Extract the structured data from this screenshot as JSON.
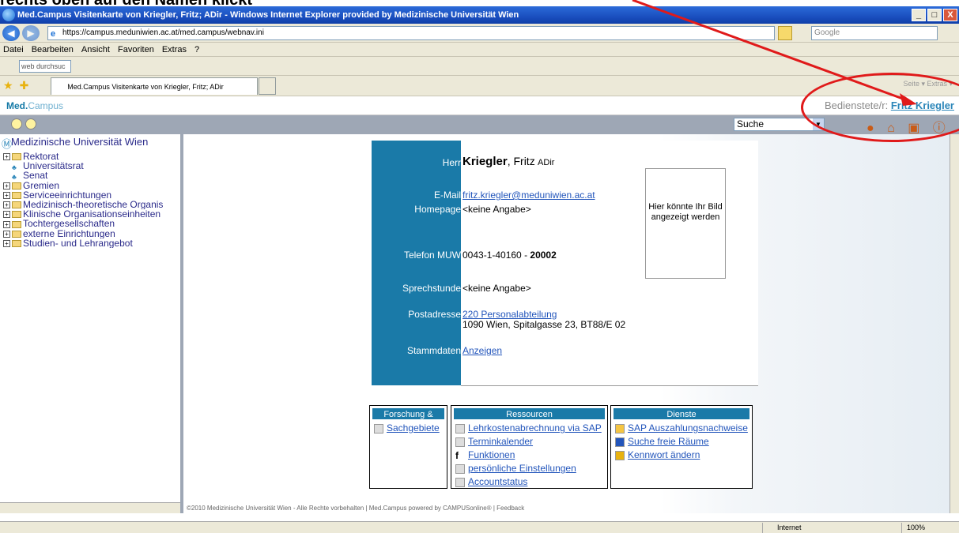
{
  "window": {
    "title": "Med.Campus Visitenkarte von Kriegler, Fritz; ADir - Windows Internet Explorer provided by Medizinische Universität Wien",
    "min": "_",
    "max": "□",
    "close": "X"
  },
  "browser": {
    "url": "https://campus.meduniwien.ac.at/med.campus/webnav.ini",
    "search_placeholder": "Google",
    "menu": [
      "Datei",
      "Bearbeiten",
      "Ansicht",
      "Favoriten",
      "Extras",
      "?"
    ],
    "web_search": "web durchsuc",
    "tab_title": "Med.Campus Visitenkarte von Kriegler, Fritz; ADir",
    "right_cmds": "Seite ▾  Extras ▾",
    "status_zone": "Internet",
    "zoom": "100%"
  },
  "app": {
    "brand_main": "Med.",
    "brand_sub": "Campus",
    "user_prefix": "Bedienstete/r: ",
    "user_name": "Fritz Kriegler",
    "search_select": "Suche"
  },
  "sidebar": {
    "title": "Medizinische Universität Wien",
    "items": [
      {
        "label": "Rektorat",
        "type": "folder"
      },
      {
        "label": "Universitätsrat",
        "type": "person"
      },
      {
        "label": "Senat",
        "type": "person"
      },
      {
        "label": "Gremien",
        "type": "folder"
      },
      {
        "label": "Serviceeinrichtungen",
        "type": "folder"
      },
      {
        "label": "Medizinisch-theoretische Organis",
        "type": "folder"
      },
      {
        "label": "Klinische Organisationseinheiten",
        "type": "folder"
      },
      {
        "label": "Tochtergesellschaften",
        "type": "folder"
      },
      {
        "label": "externe Einrichtungen",
        "type": "folder"
      },
      {
        "label": "Studien- und Lehrangebot",
        "type": "folder"
      }
    ]
  },
  "card": {
    "salutation": "Herr",
    "last_name": "Kriegler",
    "first_name": "Fritz",
    "title": "ADir",
    "email_label": "E-Mail",
    "email": "fritz.kriegler@meduniwien.ac.at",
    "homepage_label": "Homepage",
    "homepage": "<keine Angabe>",
    "phone_label": "Telefon  MUW",
    "phone": "0043-1-40160 - ",
    "phone_ext": "20002",
    "office_label": "Sprechstunde",
    "office": "<keine Angabe>",
    "address_label": "Postadresse",
    "address_link": "220 Personalabteilung",
    "address_line": "1090 Wien, Spitalgasse 23, BT88/E 02",
    "master_label": "Stammdaten",
    "master_link": "Anzeigen",
    "photo_text": "Hier könnte Ihr Bild angezeigt werden"
  },
  "panels": {
    "forschung": {
      "title": "Forschung & Lehre",
      "items": [
        "Sachgebiete"
      ]
    },
    "ressourcen": {
      "title": "Ressourcen",
      "items": [
        "Lehrkostenabrechnung via SAP",
        "Terminkalender",
        "Funktionen",
        "persönliche Einstellungen",
        "Accountstatus"
      ]
    },
    "dienste": {
      "title": "Dienste",
      "items": [
        "SAP Auszahlungsnachweise",
        "Suche freie Räume",
        "Kennwort ändern"
      ]
    }
  },
  "footer": "©2010 Medizinische Universität Wien - Alle Rechte vorbehalten | Med.Campus powered by CAMPUSonline® | Feedback",
  "caption": "rechts oben auf den Namen klickt",
  "colors": {
    "accent": "#1a7aa8",
    "annotation": "#e01a1a",
    "link": "#2255bb"
  }
}
